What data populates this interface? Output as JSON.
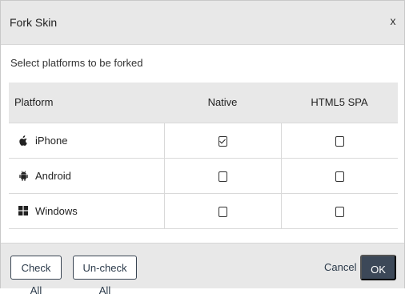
{
  "dialog": {
    "title": "Fork Skin",
    "close_label": "x",
    "instruction": "Select platforms to be forked"
  },
  "table": {
    "headers": {
      "platform": "Platform",
      "native": "Native",
      "html5": "HTML5 SPA"
    },
    "rows": [
      {
        "platform": "iPhone",
        "icon": "apple-icon",
        "native": true,
        "html5": false
      },
      {
        "platform": "Android",
        "icon": "android-icon",
        "native": false,
        "html5": false
      },
      {
        "platform": "Windows",
        "icon": "windows-icon",
        "native": false,
        "html5": false
      }
    ]
  },
  "footer": {
    "check_all_label": "Check All",
    "uncheck_all_label": "Un-check All",
    "cancel_label": "Cancel",
    "ok_label": "OK"
  },
  "colors": {
    "header_bg": "#e8e8e8",
    "primary_button": "#3c4858",
    "outline_border": "#3a4654"
  }
}
